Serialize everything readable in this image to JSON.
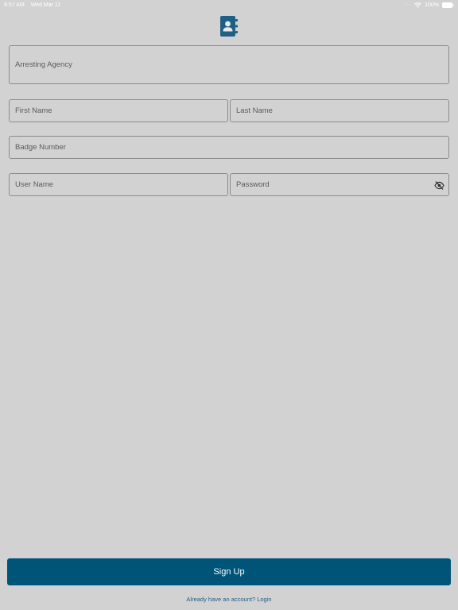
{
  "status_bar": {
    "time": "8:57 AM",
    "date": "Wed Mar 11",
    "battery_percent": "100%",
    "battery_level": 1.0
  },
  "logo": {
    "icon": "contact-book-icon",
    "color": "#1f5f86"
  },
  "form": {
    "arresting_agency": {
      "placeholder": "Arresting Agency",
      "value": ""
    },
    "first_name": {
      "placeholder": "First Name",
      "value": ""
    },
    "last_name": {
      "placeholder": "Last Name",
      "value": ""
    },
    "badge_number": {
      "placeholder": "Badge Number",
      "value": ""
    },
    "user_name": {
      "placeholder": "User Name",
      "value": ""
    },
    "password": {
      "placeholder": "Password",
      "value": "",
      "visibility_icon": "eye-off-icon"
    }
  },
  "actions": {
    "signup_label": "Sign Up",
    "login_link": "Already have an account? Login"
  },
  "colors": {
    "background": "#d2d2d2",
    "primary": "#005478",
    "link": "#1f5f86",
    "field_border": "#8b8b8b"
  }
}
